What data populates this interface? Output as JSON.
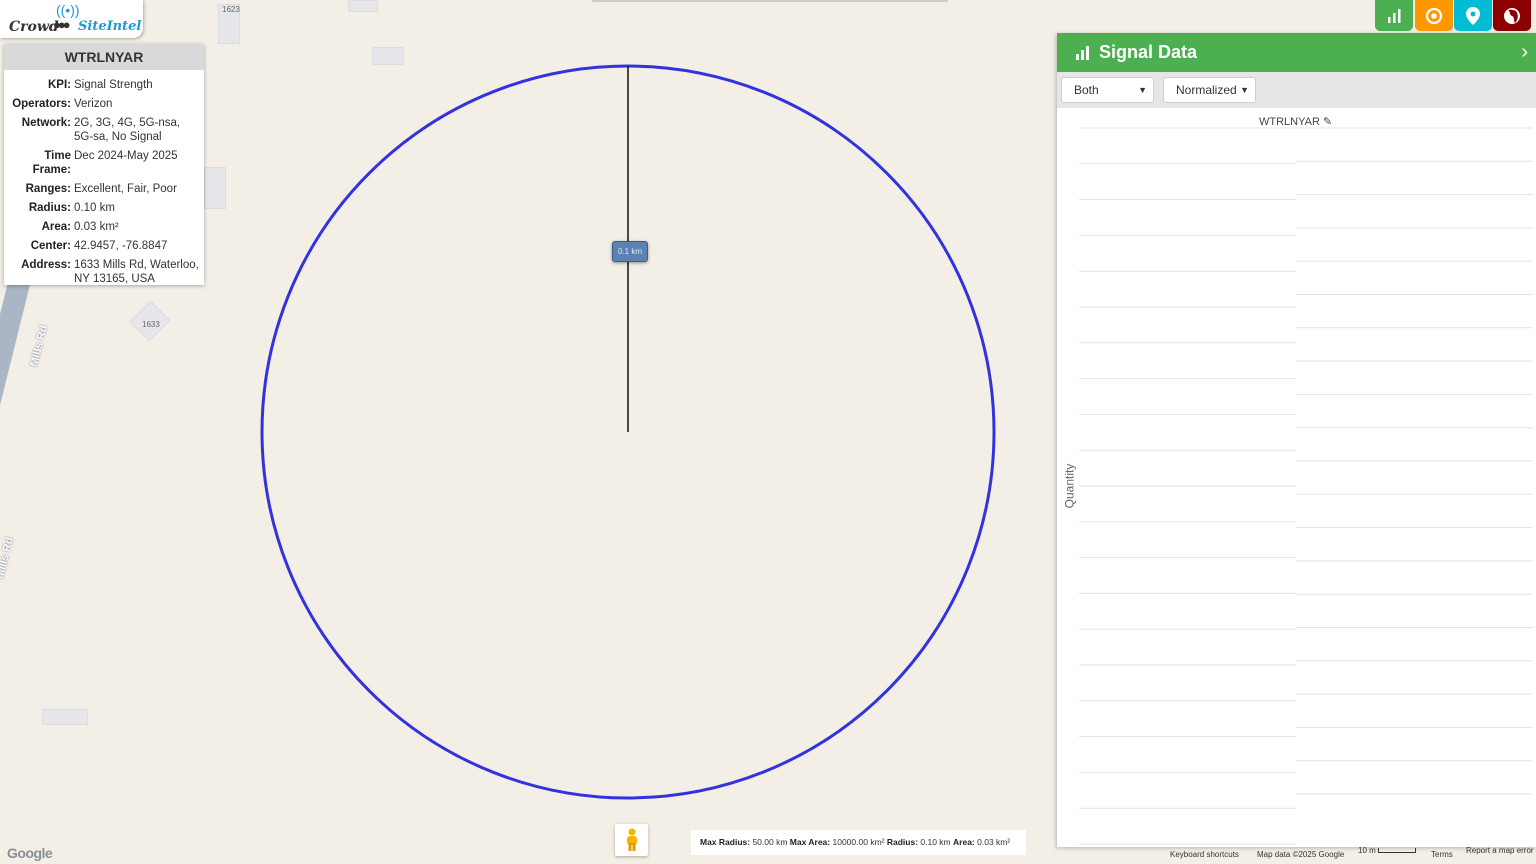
{
  "logo": {
    "crowd": "Crowd",
    "site": "SiteIntel"
  },
  "map": {
    "house_numbers": [
      "1623",
      "1633"
    ],
    "road_label": "Mills Rd",
    "radius_tag": "0.1 km",
    "google_wordmark": "Google"
  },
  "info": {
    "title": "WTRLNYAR",
    "rows": [
      {
        "key": "KPI:",
        "value": "Signal Strength"
      },
      {
        "key": "Operators:",
        "value": "Verizon"
      },
      {
        "key": "Network:",
        "value": "2G, 3G, 4G, 5G-nsa, 5G-sa, No Signal"
      },
      {
        "key": "Time Frame:",
        "value": "Dec 2024-May 2025"
      },
      {
        "key": "Ranges:",
        "value": "Excellent, Fair, Poor"
      },
      {
        "key": "Radius:",
        "value": "0.10 km"
      },
      {
        "key": "Area:",
        "value": "0.03 km²"
      },
      {
        "key": "Center:",
        "value": "42.9457, -76.8847"
      },
      {
        "key": "Address:",
        "value": "1633 Mills Rd, Waterloo, NY 13165, USA"
      }
    ]
  },
  "toolbar": {
    "buttons": [
      {
        "name": "chart-button",
        "icon": "bar-chart-icon",
        "color": "#4caf50"
      },
      {
        "name": "target-button",
        "icon": "target-icon",
        "color": "#ff9800"
      },
      {
        "name": "location-button",
        "icon": "map-pin-icon",
        "color": "#00bcd4"
      },
      {
        "name": "globe-button",
        "icon": "globe-icon",
        "color": "#8b0000"
      }
    ]
  },
  "signal_panel": {
    "title": "Signal Data",
    "mode_select": "Both",
    "scale_select": "Normalized",
    "chart_title": "WTRLNYAR",
    "y_label": "Quantity"
  },
  "stats_bar": {
    "max_radius_label": "Max Radius:",
    "max_radius_value": "50.00 km",
    "max_area_label": "Max Area:",
    "max_area_value": "10000.00 km²",
    "radius_label": "Radius:",
    "radius_value": "0.10 km",
    "area_label": "Area:",
    "area_value": "0.03 km²"
  },
  "footer": {
    "keyboard": "Keyboard shortcuts",
    "map_data": "Map data ©2025 Google",
    "scale": "10 m",
    "terms": "Terms",
    "report": "Report a map error"
  },
  "colors": {
    "circle": "#3333dd",
    "panel_header": "#4caf50"
  }
}
